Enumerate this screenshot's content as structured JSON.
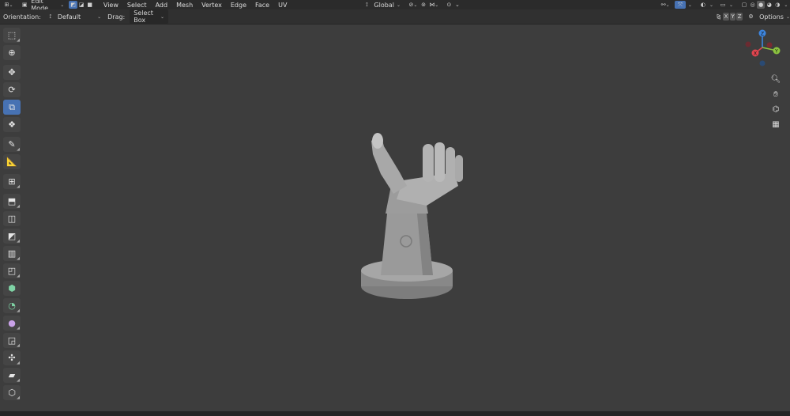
{
  "header": {
    "mode": "Edit Mode",
    "menus": [
      "View",
      "Select",
      "Add",
      "Mesh",
      "Vertex",
      "Edge",
      "Face",
      "UV"
    ],
    "transform_orientation": "Global",
    "icons": [
      "editor-type-icon",
      "vertex-select-icon",
      "edge-select-icon",
      "face-select-icon",
      "pivot-icon",
      "snap-icon",
      "proportional-edit-icon",
      "gizmo-icon",
      "overlay-icon",
      "xray-icon",
      "wireframe-shading-icon",
      "solid-shading-icon",
      "material-shading-icon",
      "rendered-shading-icon"
    ]
  },
  "tool_settings": {
    "orientation_label": "Orientation:",
    "orientation_value": "Default",
    "drag_label": "Drag:",
    "drag_value": "Select Box",
    "mirror_x": "X",
    "mirror_y": "Y",
    "mirror_z": "Z",
    "options_label": "Options"
  },
  "toolbar": {
    "tools": [
      "select-box",
      "cursor",
      "move",
      "rotate",
      "scale",
      "transform",
      "annotate",
      "measure",
      "add-cube",
      "extrude-region",
      "inset-faces",
      "bevel",
      "loop-cut",
      "knife",
      "poly-build",
      "spin",
      "smooth",
      "edge-slide",
      "shrink-fatten",
      "shear",
      "rip-region"
    ],
    "active": "scale"
  },
  "gizmo": {
    "axes": [
      "X",
      "Y",
      "Z"
    ],
    "colors": {
      "x": "#e0454f",
      "y": "#8cc43f",
      "z": "#3d86e0"
    }
  },
  "nav_buttons": [
    "zoom-icon",
    "hand-pan-icon",
    "camera-icon",
    "grid-ortho-icon"
  ],
  "viewport": {
    "background": "#3d3d3d",
    "object": "hand-on-pedestal-mesh"
  }
}
